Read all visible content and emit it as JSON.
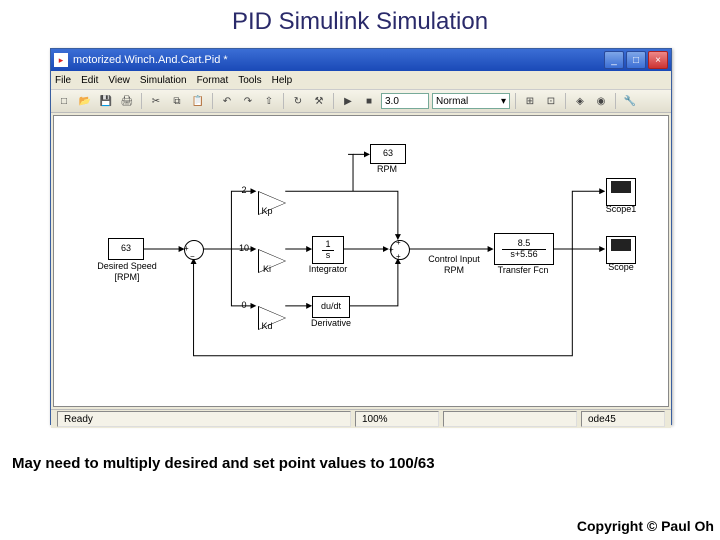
{
  "slide": {
    "title": "PID Simulink Simulation"
  },
  "window": {
    "title": "motorized.Winch.And.Cart.Pid *",
    "menus": [
      "File",
      "Edit",
      "View",
      "Simulation",
      "Format",
      "Tools",
      "Help"
    ],
    "toolbar": {
      "stop_time": "3.0",
      "mode": "Normal"
    },
    "status": {
      "ready": "Ready",
      "zoom": "100%",
      "solver": "ode45"
    }
  },
  "blocks": {
    "desired": {
      "value": "63",
      "label1": "Desired Speed",
      "label2": "[RPM]"
    },
    "rpm_disp": {
      "value": "63",
      "label": "RPM"
    },
    "kp": {
      "value": "2",
      "label": "Kp"
    },
    "ki": {
      "value": "10",
      "label": "Ki"
    },
    "kd": {
      "value": "0",
      "label": "Kd"
    },
    "integrator": {
      "expr_top": "1",
      "expr_bot": "s",
      "label": "Integrator"
    },
    "derivative": {
      "expr": "du/dt",
      "label": "Derivative"
    },
    "control": {
      "label1": "Control Input",
      "label2": "RPM"
    },
    "tf": {
      "num": "8.5",
      "den": "s+5.56",
      "label": "Transfer Fcn"
    },
    "scope": {
      "label": "Scope"
    },
    "scope1": {
      "label": "Scope1"
    }
  },
  "footer": {
    "note": "May need to multiply desired and set point values to 100/63",
    "copyright": "Copyright © Paul Oh"
  }
}
